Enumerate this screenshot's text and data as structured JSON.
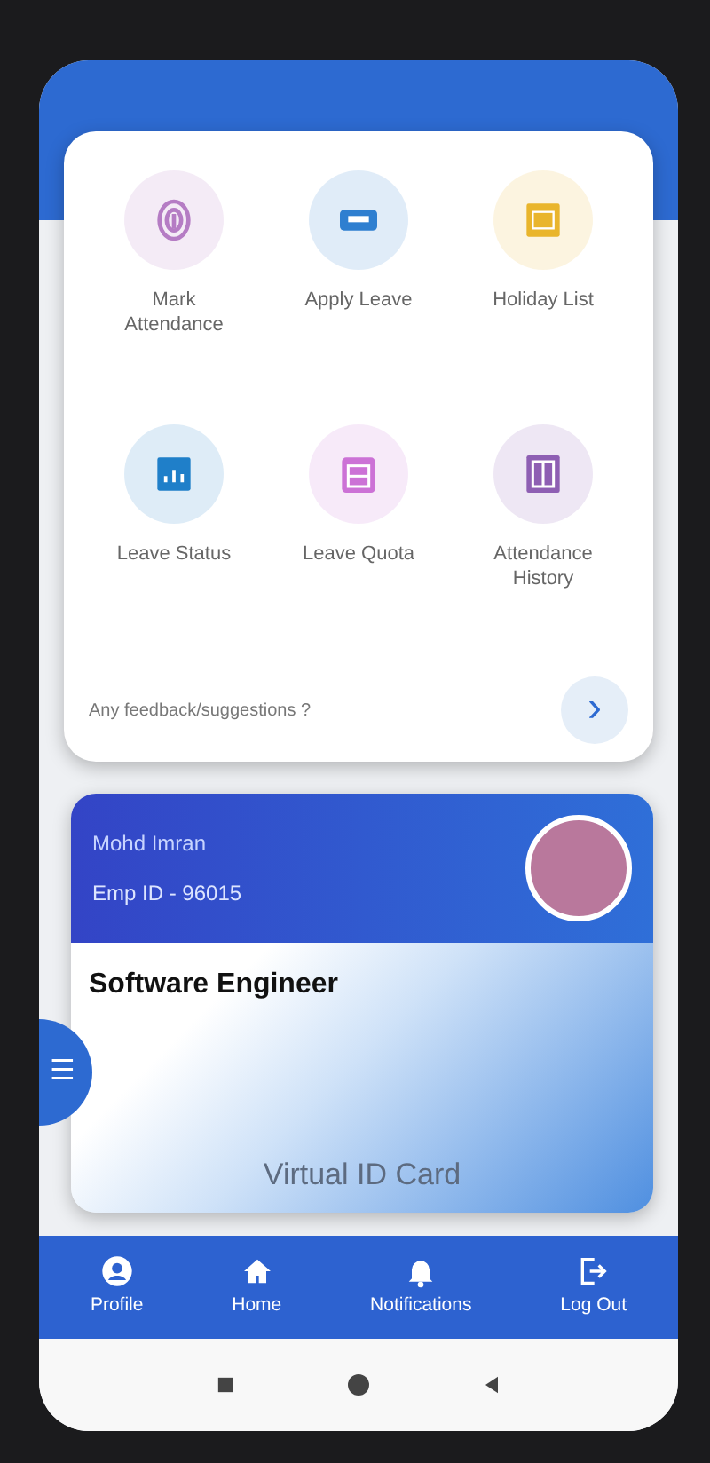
{
  "menu_items": [
    {
      "label": "Mark Attendance",
      "kind": "fingerprint",
      "color": "#b57cc4"
    },
    {
      "label": "Apply Leave",
      "kind": "ticket",
      "color": "#2f7fd0"
    },
    {
      "label": "Holiday List",
      "kind": "list",
      "color": "#e9b52c"
    },
    {
      "label": "Leave Status",
      "kind": "chart",
      "color": "#1f7fc9"
    },
    {
      "label": "Leave Quota",
      "kind": "calendar",
      "color": "#cc72d6"
    },
    {
      "label": "Attendance History",
      "kind": "history",
      "color": "#8e5fb3"
    }
  ],
  "feedback": {
    "label": "Any feedback/suggestions ?",
    "button": "›"
  },
  "id_card": {
    "name": "Mohd Imran",
    "emp_id": "Emp ID - 96015",
    "designation": "Software Engineer",
    "footer": "Virtual ID Card"
  },
  "side_menu": "☰",
  "bottom_nav": [
    {
      "label": "Profile",
      "kind": "profile"
    },
    {
      "label": "Home",
      "kind": "home"
    },
    {
      "label": "Notifications",
      "kind": "bell"
    },
    {
      "label": "Log Out",
      "kind": "logout"
    }
  ]
}
